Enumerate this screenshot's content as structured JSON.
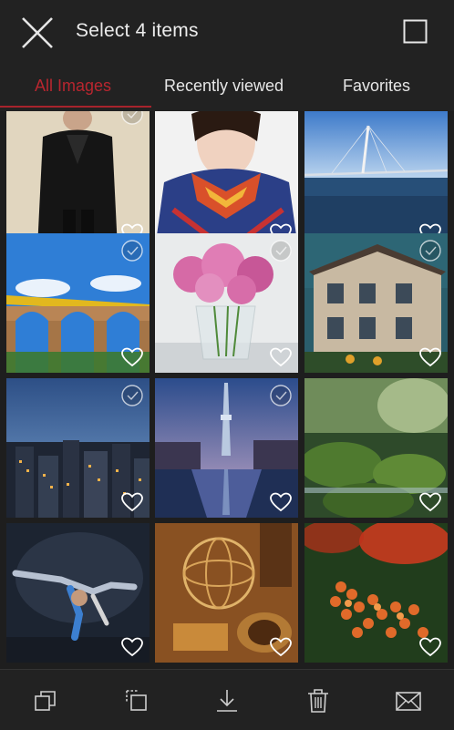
{
  "header": {
    "title": "Select 4 items",
    "close_icon": "close-icon",
    "select_all_icon": "checkbox-icon"
  },
  "tabs": [
    {
      "label": "All Images",
      "active": true
    },
    {
      "label": "Recently viewed",
      "active": false
    },
    {
      "label": "Favorites",
      "active": false
    }
  ],
  "accent_color": "#b8262f",
  "gallery": {
    "photos": [
      {
        "subject": "man in black suit"
      },
      {
        "subject": "woman with colorful scarf"
      },
      {
        "subject": "cable-stayed bridge over sea"
      },
      {
        "subject": "yellow train on stone viaduct"
      },
      {
        "subject": "pink peonies in glass vase"
      },
      {
        "subject": "beige villa house"
      },
      {
        "subject": "city skyline at dusk"
      },
      {
        "subject": "tower reflected in canal"
      },
      {
        "subject": "mossy rocks in stream"
      },
      {
        "subject": "breakdancer freeze pose"
      },
      {
        "subject": "antique globe and telescope"
      },
      {
        "subject": "orange berries on branch"
      }
    ]
  },
  "bottom_actions": [
    {
      "name": "copy-icon"
    },
    {
      "name": "move-icon"
    },
    {
      "name": "download-icon"
    },
    {
      "name": "delete-icon"
    },
    {
      "name": "mail-icon"
    }
  ]
}
